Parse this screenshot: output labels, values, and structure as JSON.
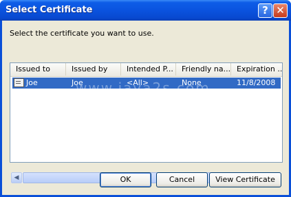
{
  "window": {
    "title": "Select Certificate",
    "help_label": "?",
    "close_label": "✕"
  },
  "prompt": "Select the certificate you want to use.",
  "columns": [
    "Issued to",
    "Issued by",
    "Intended P...",
    "Friendly na...",
    "Expiration ..."
  ],
  "rows": [
    {
      "issued_to": "Joe",
      "issued_by": "Joe",
      "intended_purposes": "<All>",
      "friendly_name": "None",
      "expiration": "11/8/2008",
      "selected": true
    }
  ],
  "watermark": "www.java2s.com",
  "scrollbar": {
    "left_arrow": "◀",
    "right_arrow": "▶",
    "grip": "|||"
  },
  "buttons": {
    "ok": "OK",
    "cancel": "Cancel",
    "view": "View Certificate"
  },
  "colors": {
    "title_bar": "#0a53df",
    "selection": "#316ac5",
    "dialog_bg": "#ece9d8"
  },
  "icons": {
    "row_icon": "certificate-icon"
  }
}
